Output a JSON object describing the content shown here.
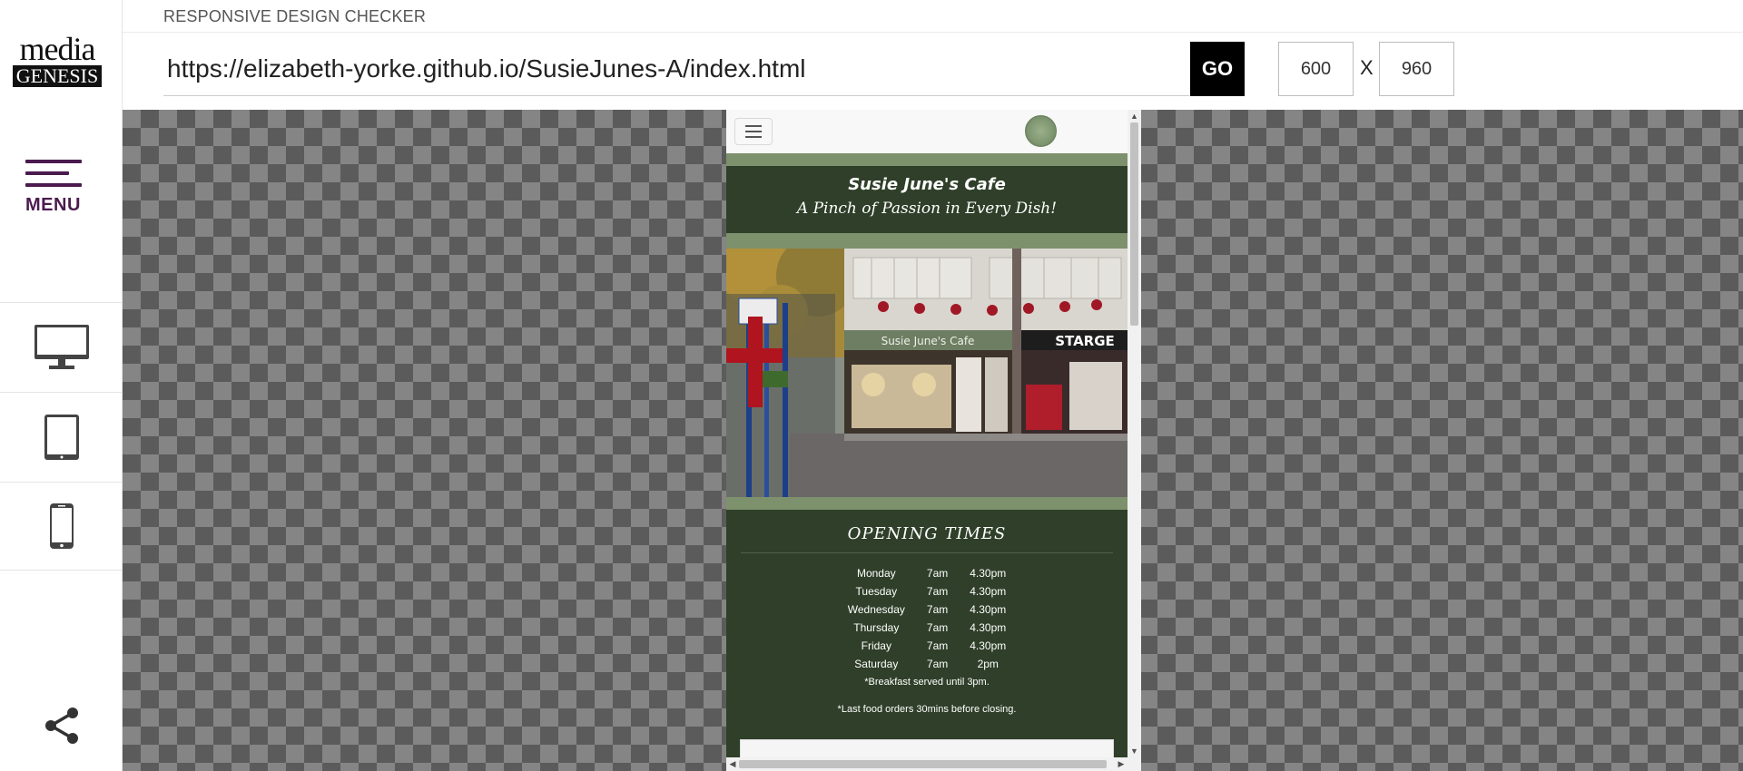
{
  "app": {
    "title": "RESPONSIVE DESIGN CHECKER",
    "logo_top": "media",
    "logo_bottom": "GENESIS"
  },
  "sidebar": {
    "menu_label": "MENU",
    "devices": [
      {
        "name": "desktop",
        "icon": "desktop-monitor-icon"
      },
      {
        "name": "tablet",
        "icon": "tablet-icon"
      },
      {
        "name": "phone",
        "icon": "phone-icon"
      }
    ],
    "share_icon": "share-icon"
  },
  "toolbar": {
    "url": "https://elizabeth-yorke.github.io/SusieJunes-A/index.html",
    "go_label": "GO",
    "width": "600",
    "height": "960",
    "separator": "X"
  },
  "preview": {
    "site_title": "Susie June's Cafe",
    "site_tagline": "A Pinch of Passion in Every Dish!",
    "photo_sign": "Susie June's Cafe",
    "photo_shop_right": "STARGE",
    "opening_title": "OPENING TIMES",
    "hours": [
      {
        "day": "Monday",
        "open": "7am",
        "close": "4.30pm"
      },
      {
        "day": "Tuesday",
        "open": "7am",
        "close": "4.30pm"
      },
      {
        "day": "Wednesday",
        "open": "7am",
        "close": "4.30pm"
      },
      {
        "day": "Thursday",
        "open": "7am",
        "close": "4.30pm"
      },
      {
        "day": "Friday",
        "open": "7am",
        "close": "4.30pm"
      },
      {
        "day": "Saturday",
        "open": "7am",
        "close": "2pm"
      }
    ],
    "note_breakfast": "*Breakfast served until 3pm.",
    "note_last_orders": "*Last food orders 30mins before closing."
  },
  "colors": {
    "accent_purple": "#4b1a4f",
    "cafe_green_dark": "#2f3f29",
    "cafe_green_light": "#7d916d",
    "go_button": "#000000"
  }
}
